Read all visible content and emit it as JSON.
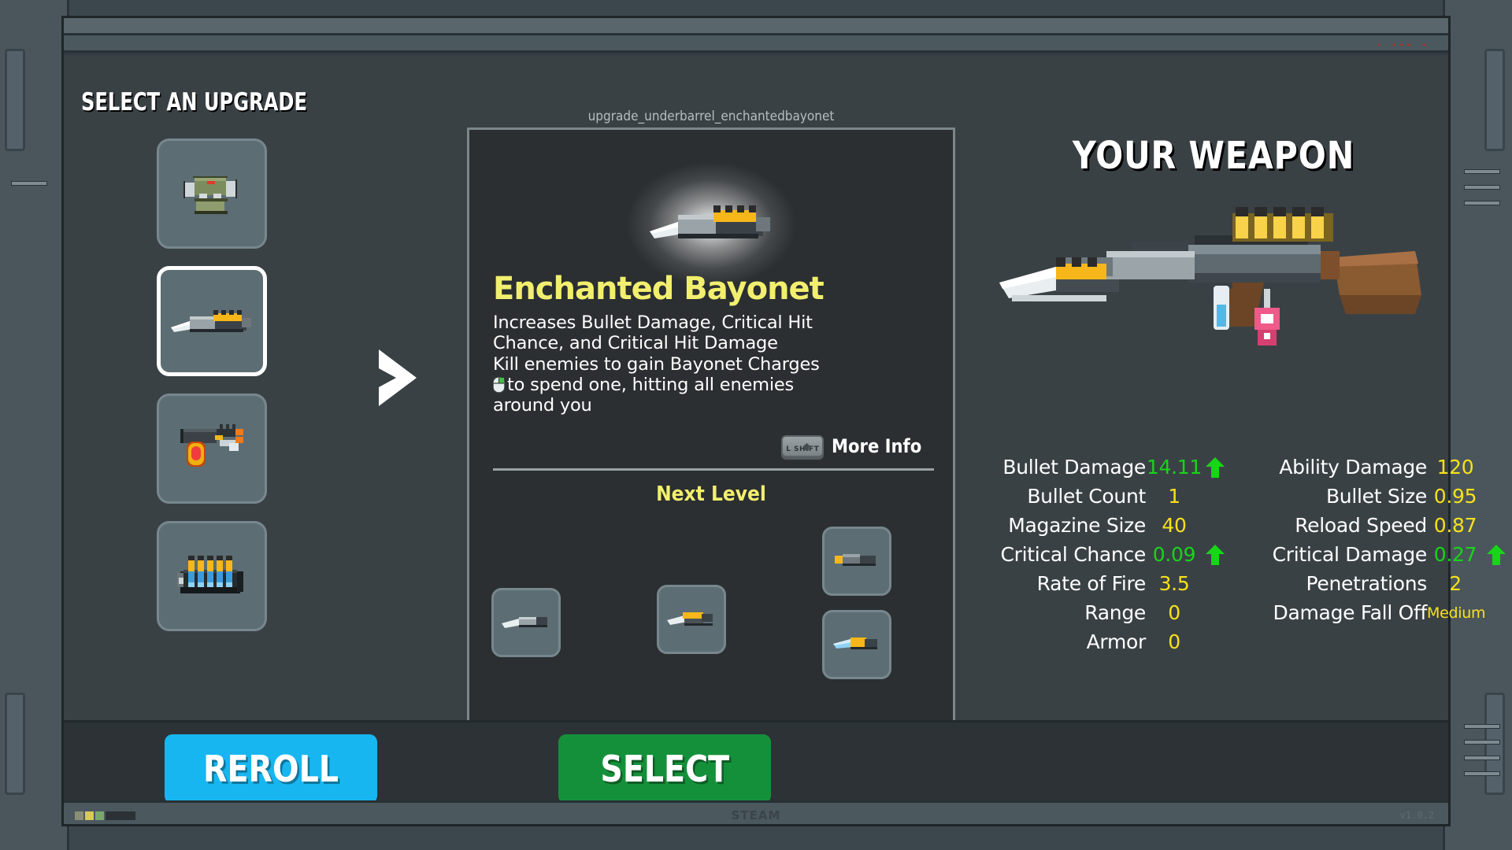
{
  "headings": {
    "select_upgrade": "SELECT AN UPGRADE",
    "your_weapon": "YOUR WEAPON"
  },
  "card": {
    "internal_id": "upgrade_underbarrel_enchantedbayonet",
    "item_name": "Enchanted Bayonet",
    "description_lines": [
      "Increases Bullet Damage, Critical Hit",
      "Chance, and Critical Hit Damage",
      "Kill enemies to gain Bayonet Charges",
      "to spend one, hitting all enemies",
      "around you"
    ],
    "more_info_key": "L SHIFT",
    "more_info_label": "More Info",
    "next_level_label": "Next Level"
  },
  "upgrade_choices": [
    {
      "icon": "scope-attachment-icon",
      "selected": false
    },
    {
      "icon": "enchanted-bayonet-icon",
      "selected": true
    },
    {
      "icon": "flame-launcher-icon",
      "selected": false
    },
    {
      "icon": "ammo-clip-icon",
      "selected": false
    }
  ],
  "next_level_items": [
    {
      "icon": "bayonet-knife-plain-icon"
    },
    {
      "icon": "bayonet-knife-gold-icon"
    },
    {
      "icon": "bayonet-short-icon"
    },
    {
      "icon": "bayonet-blue-icon"
    }
  ],
  "weapon_stats": {
    "left_column": [
      {
        "label": "Bullet Damage",
        "value": "14.11",
        "increased": true
      },
      {
        "label": "Bullet Count",
        "value": "1",
        "increased": false
      },
      {
        "label": "Magazine Size",
        "value": "40",
        "increased": false
      },
      {
        "label": "Critical Chance",
        "value": "0.09",
        "increased": true
      },
      {
        "label": "Rate of Fire",
        "value": "3.5",
        "increased": false
      },
      {
        "label": "Range",
        "value": "0",
        "increased": false
      },
      {
        "label": "Armor",
        "value": "0",
        "increased": false
      }
    ],
    "right_column": [
      {
        "label": "Ability Damage",
        "value": "120",
        "increased": false
      },
      {
        "label": "Bullet Size",
        "value": "0.95",
        "increased": false
      },
      {
        "label": "Reload Speed",
        "value": "0.87",
        "increased": false
      },
      {
        "label": "Critical Damage",
        "value": "0.27",
        "increased": true
      },
      {
        "label": "Penetrations",
        "value": "2",
        "increased": false
      },
      {
        "label": "Damage Fall Off",
        "value": "Medium",
        "increased": false,
        "small": true
      }
    ]
  },
  "actions": {
    "reroll_label": "REROLL",
    "select_label": "SELECT"
  },
  "chrome": {
    "corner_dots": "• ••• •",
    "bottom_center_watermark": "STEAM",
    "bottom_right_text": "v1.0.2"
  },
  "colors": {
    "accent_yellow": "#f7e11a",
    "title_yellow": "#f2ef6e",
    "stat_up_green": "#17d517",
    "reroll_blue": "#18b6f0",
    "select_green": "#15903a",
    "panel_dark": "#2b2f31",
    "slot_fill": "#5c6d73"
  }
}
